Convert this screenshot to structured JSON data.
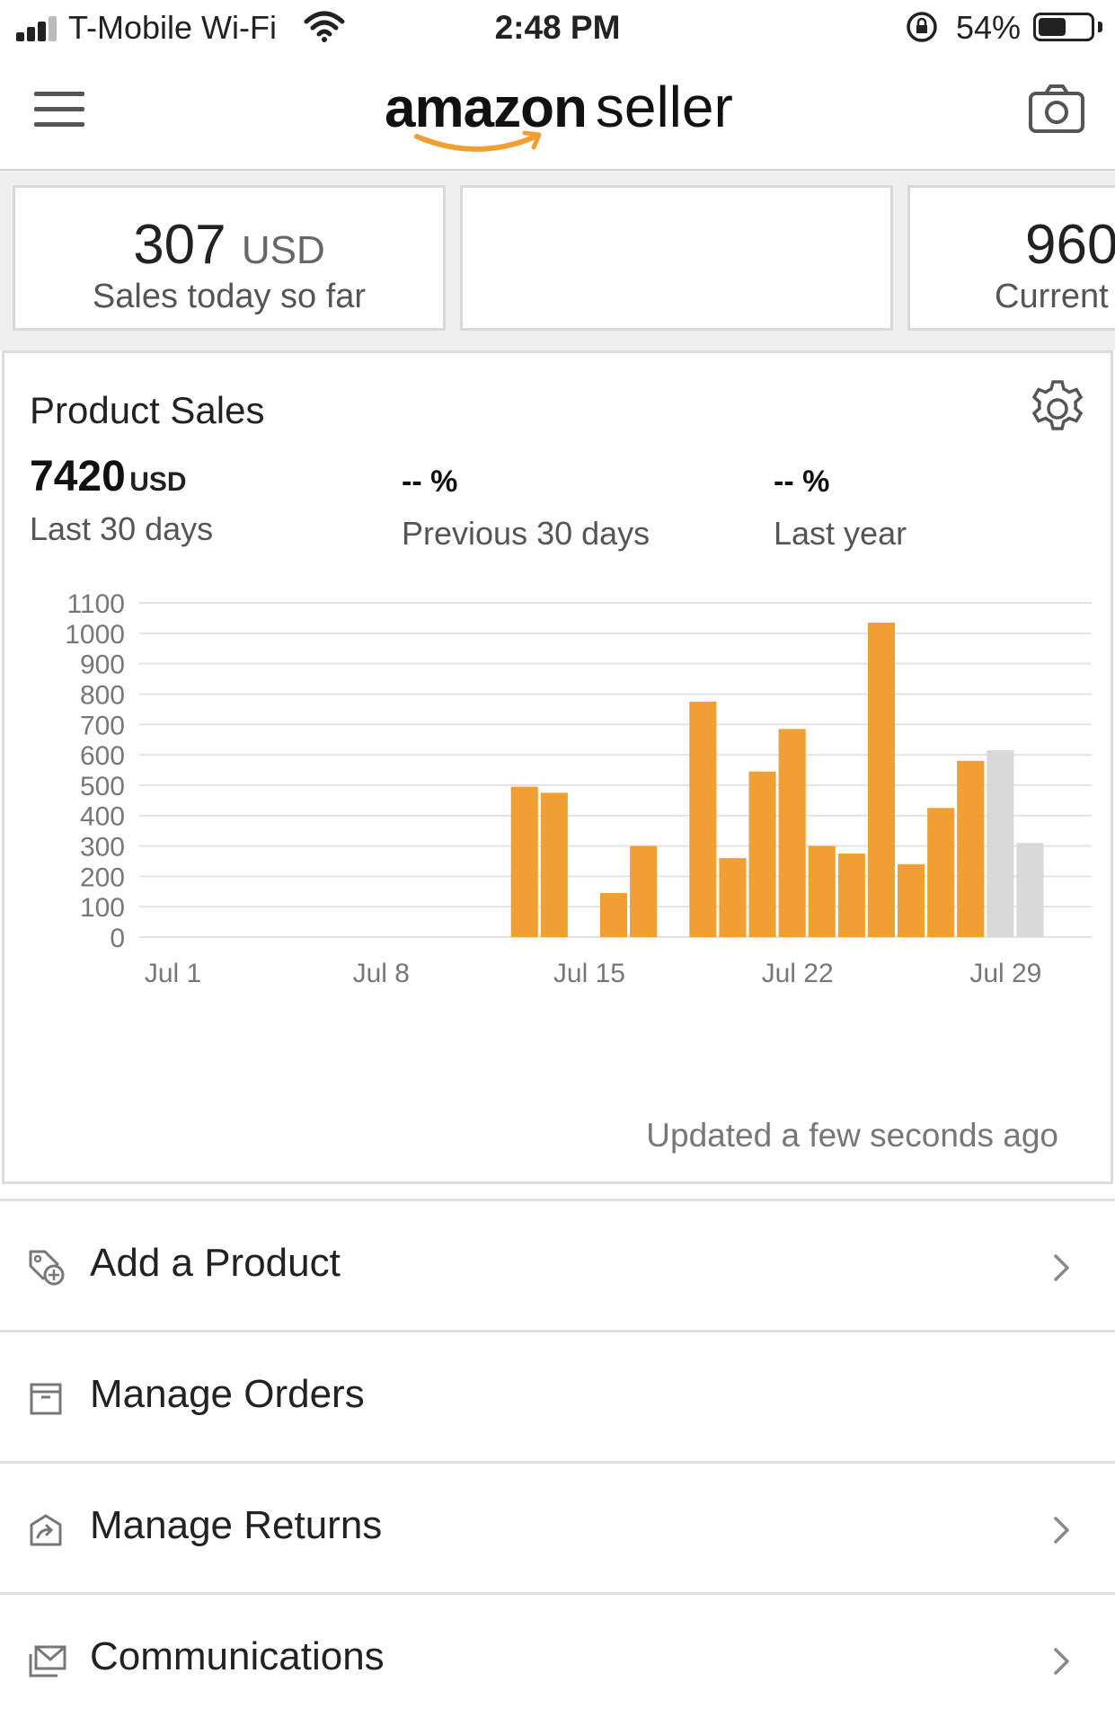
{
  "status_bar": {
    "carrier": "T-Mobile Wi-Fi",
    "time": "2:48 PM",
    "battery_percent_label": "54%",
    "battery_level": 0.54,
    "signal_bars": 3
  },
  "header": {
    "logo_main": "amazon",
    "logo_sub": "seller",
    "brand_color": "#f0a032"
  },
  "cards": [
    {
      "value": "307",
      "unit": "USD",
      "label": "Sales today so far"
    },
    {
      "value": "",
      "unit": "",
      "label": ""
    },
    {
      "value": "960",
      "unit": "",
      "label": "Current"
    }
  ],
  "product_sales": {
    "title": "Product Sales",
    "stats": [
      {
        "value": "7420",
        "unit": "USD",
        "label": "Last 30 days"
      },
      {
        "value": "-- %",
        "unit": "",
        "label": "Previous 30 days"
      },
      {
        "value": "-- %",
        "unit": "",
        "label": "Last year"
      }
    ],
    "updated": "Updated a few seconds ago"
  },
  "chart_data": {
    "type": "bar",
    "x_tick_labels": [
      "Jul 1",
      "Jul 8",
      "Jul 15",
      "Jul 22",
      "Jul 29"
    ],
    "x_tick_days": [
      1,
      8,
      15,
      22,
      29
    ],
    "ylim": [
      0,
      1100
    ],
    "y_ticks": [
      0,
      100,
      200,
      300,
      400,
      500,
      600,
      700,
      800,
      900,
      1000,
      1100
    ],
    "grid": true,
    "series": [
      {
        "color": "#f0a032",
        "days": [
          13,
          14,
          16,
          17,
          19,
          20,
          21,
          22,
          23,
          24,
          25,
          26,
          27,
          28
        ],
        "values": [
          495,
          475,
          145,
          300,
          775,
          260,
          545,
          685,
          300,
          275,
          1035,
          240,
          425,
          580
        ]
      },
      {
        "color": "#d9d9d9",
        "days": [
          29,
          30
        ],
        "values": [
          615,
          310
        ]
      }
    ]
  },
  "list": [
    {
      "label": "Add a Product",
      "icon": "tag-plus-icon",
      "chevron": true
    },
    {
      "label": "Manage Orders",
      "icon": "box-icon",
      "chevron": false
    },
    {
      "label": "Manage Returns",
      "icon": "return-box-icon",
      "chevron": true
    },
    {
      "label": "Communications",
      "icon": "envelope-icon",
      "chevron": true
    }
  ]
}
